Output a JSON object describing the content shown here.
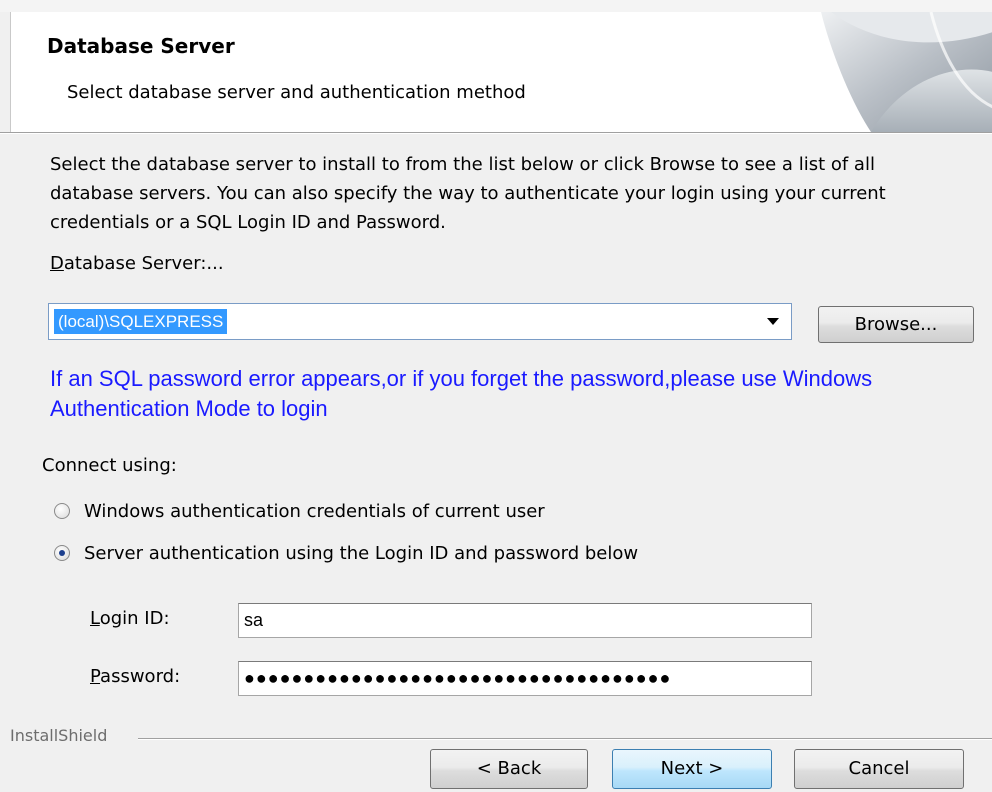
{
  "header": {
    "title": "Database Server",
    "subtitle": "Select database server and authentication method"
  },
  "description": "Select the database server to install to from the list below or click Browse to see a list of all database servers. You can also specify the way to authenticate your login using your current credentials or a SQL Login ID and Password.",
  "server": {
    "label_first": "D",
    "label_rest": "atabase Server:...",
    "selected_value": "(local)\\SQLEXPRESS",
    "browse_label": "Browse..."
  },
  "hint": "If an SQL password error appears,or if you forget the password,please use Windows Authentication Mode to login",
  "connect": {
    "label": "Connect using:",
    "option_windows": "Windows authentication credentials of current user",
    "option_server": "Server authentication using the Login ID and password below",
    "selected": "server"
  },
  "fields": {
    "login_label_first": "L",
    "login_label_rest": "ogin ID:",
    "login_value": "sa",
    "password_label_first": "P",
    "password_label_rest": "assword:",
    "password_value": "●●●●●●●●●●●●●●●●●●●●●●●●●●●●●●●●●●●●"
  },
  "footer": {
    "brand": "InstallShield",
    "back_label": "< Back",
    "next_label": "Next >",
    "cancel_label": "Cancel"
  },
  "colors": {
    "hint": "#1a1aff",
    "selection": "#3399ff"
  }
}
